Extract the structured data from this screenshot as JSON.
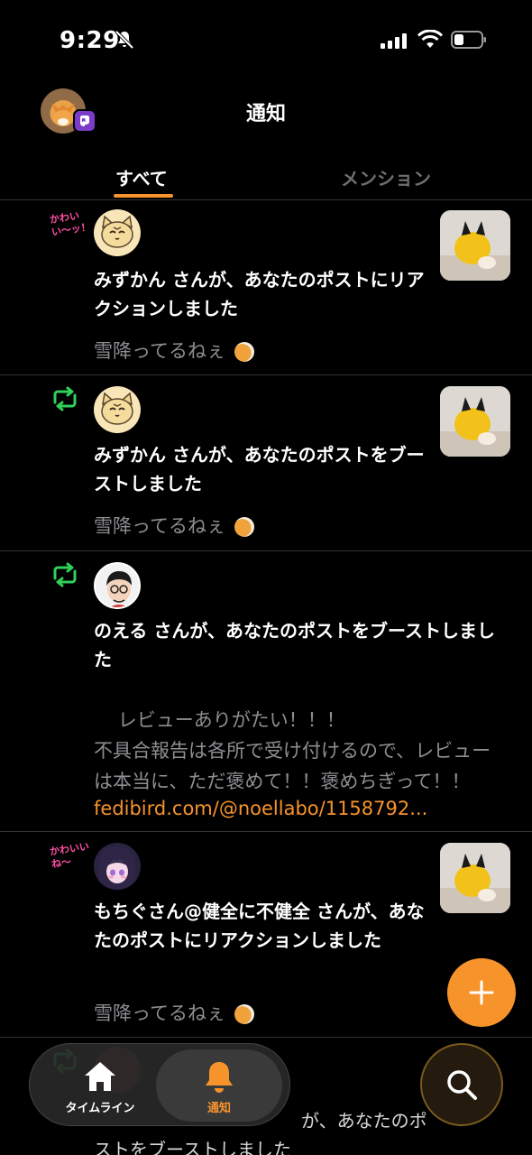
{
  "status_bar": {
    "time": "9:29",
    "icons": [
      "bell-slash-icon",
      "signal-icon",
      "wifi-icon",
      "battery-icon"
    ]
  },
  "header": {
    "title": "通知",
    "tabs": [
      {
        "label": "すべて",
        "selected": true
      },
      {
        "label": "メンション",
        "selected": false
      }
    ]
  },
  "notifications": [
    {
      "type": "reaction",
      "badge": "かわいい〜ッ！",
      "text": "みずかん さんが、あなたのポストにリアクションしました",
      "excerpt": "雪降ってるねぇ"
    },
    {
      "type": "boost",
      "text": "みずかん さんが、あなたのポストをブーストしました",
      "excerpt": "雪降ってるねぇ"
    },
    {
      "type": "boost",
      "text": "のえる さんが、あなたのポストをブーストしました",
      "body": "レビューありがたい！！！\n不具合報告は各所で受け付けるので、レビューは本当に、ただ褒めて！！褒めちぎって！！",
      "link": "fedibird.com/@noellabo/1158792..."
    },
    {
      "type": "reaction",
      "badge": "かわいいね〜",
      "text": "もちぐさん@健全に不健全 さんが、あなたのポストにリアクションしました",
      "excerpt": "雪降ってるねぇ"
    },
    {
      "type": "boost",
      "text": "ストをブーストしました",
      "partial_text": "が、あなたのポ"
    }
  ],
  "tab_bar": {
    "items": [
      {
        "label": "タイムライン",
        "icon": "home-icon"
      },
      {
        "label": "通知",
        "icon": "bell-icon",
        "selected": true
      }
    ]
  },
  "colors": {
    "accent": "#f7932b",
    "boost": "#30d158",
    "muted": "#8e8e93",
    "background": "#000000"
  }
}
